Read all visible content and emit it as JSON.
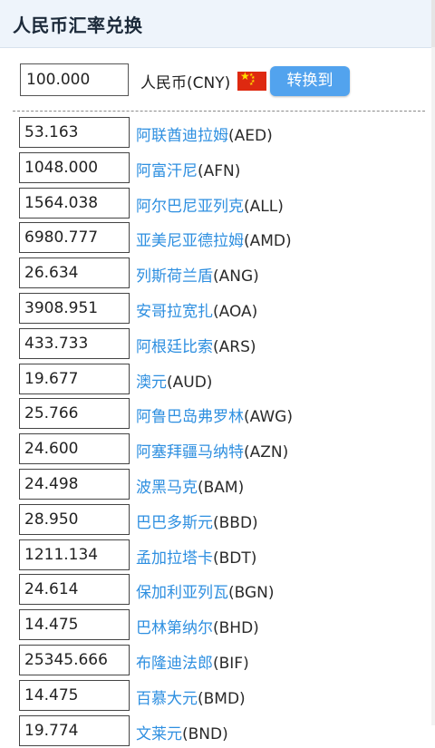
{
  "header": {
    "title": "人民币汇率兑换"
  },
  "converter": {
    "amount": "100.000",
    "base_currency": "人民币(CNY)",
    "flag": "china-flag",
    "convert_label": "转换到"
  },
  "rates": [
    {
      "value": "53.163",
      "name": "阿联酋迪拉姆",
      "code": "(AED)"
    },
    {
      "value": "1048.000",
      "name": "阿富汗尼",
      "code": "(AFN)"
    },
    {
      "value": "1564.038",
      "name": "阿尔巴尼亚列克",
      "code": "(ALL)"
    },
    {
      "value": "6980.777",
      "name": "亚美尼亚德拉姆",
      "code": "(AMD)"
    },
    {
      "value": "26.634",
      "name": "列斯荷兰盾",
      "code": "(ANG)"
    },
    {
      "value": "3908.951",
      "name": "安哥拉宽扎",
      "code": "(AOA)"
    },
    {
      "value": "433.733",
      "name": "阿根廷比索",
      "code": "(ARS)"
    },
    {
      "value": "19.677",
      "name": "澳元",
      "code": "(AUD)"
    },
    {
      "value": "25.766",
      "name": "阿鲁巴岛弗罗林",
      "code": "(AWG)"
    },
    {
      "value": "24.600",
      "name": "阿塞拜疆马纳特",
      "code": "(AZN)"
    },
    {
      "value": "24.498",
      "name": "波黑马克",
      "code": "(BAM)"
    },
    {
      "value": "28.950",
      "name": "巴巴多斯元",
      "code": "(BBD)"
    },
    {
      "value": "1211.134",
      "name": "孟加拉塔卡",
      "code": "(BDT)"
    },
    {
      "value": "24.614",
      "name": "保加利亚列瓦",
      "code": "(BGN)"
    },
    {
      "value": "14.475",
      "name": "巴林第纳尔",
      "code": "(BHD)"
    },
    {
      "value": "25345.666",
      "name": "布隆迪法郎",
      "code": "(BIF)"
    },
    {
      "value": "14.475",
      "name": "百慕大元",
      "code": "(BMD)"
    },
    {
      "value": "19.774",
      "name": "文莱元",
      "code": "(BND)"
    }
  ]
}
